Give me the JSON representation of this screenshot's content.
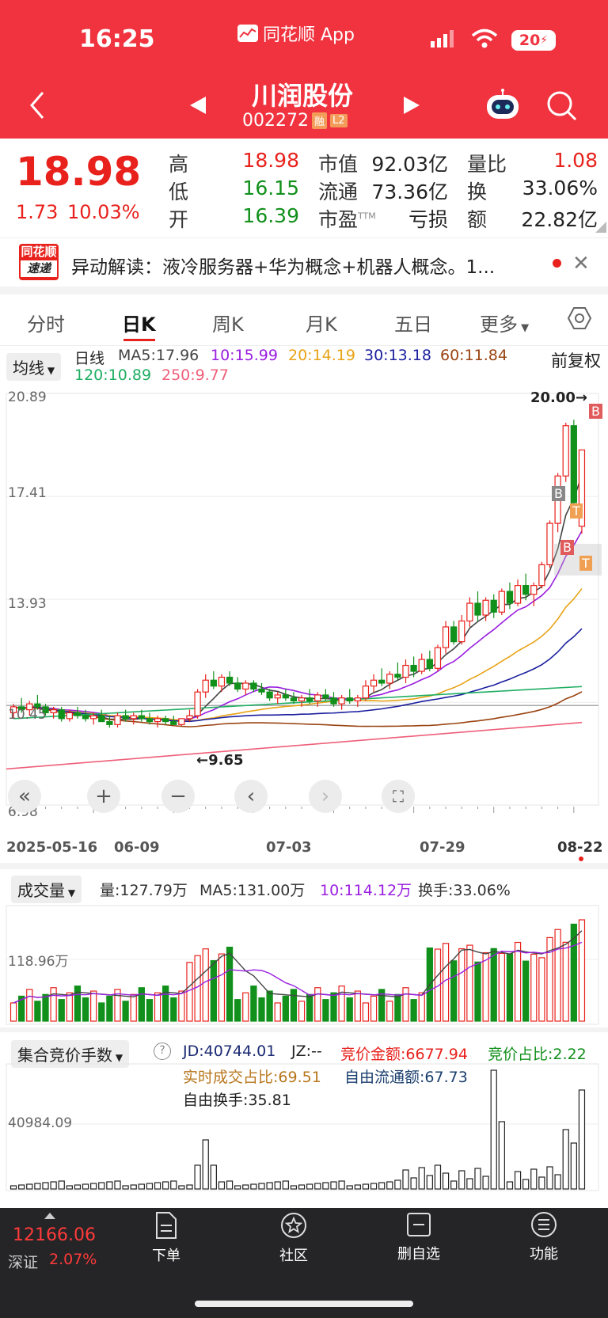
{
  "status": {
    "time": "16:25",
    "app": "同花顺 App",
    "battery": "20"
  },
  "header": {
    "title": "川润股份",
    "code": "002272",
    "badge1": "融",
    "badge2": "L2"
  },
  "quote": {
    "price": "18.98",
    "change": "1.73",
    "change_pct": "10.03%",
    "high_label": "高",
    "high": "18.98",
    "low_label": "低",
    "low": "16.15",
    "open_label": "开",
    "open": "16.39",
    "mcap_label": "市值",
    "mcap": "92.03亿",
    "float_label": "流通",
    "float": "73.36亿",
    "pe_label": "市盈",
    "pe_sup": "TTM",
    "pe": "亏损",
    "vr_label": "量比",
    "vr": "1.08",
    "turn_label": "换",
    "turn": "33.06%",
    "amt_label": "额",
    "amt": "22.82亿"
  },
  "news": {
    "logo_top": "同花顺",
    "logo_bottom": "速递",
    "text": "异动解读：液冷服务器+华为概念+机器人概念。1..."
  },
  "tabs": [
    "分时",
    "日K",
    "周K",
    "月K",
    "五日",
    "更多"
  ],
  "kline": {
    "selector": "均线",
    "period": "日线",
    "ma5": "MA5:17.96",
    "ma10": "10:15.99",
    "ma20": "20:14.19",
    "ma30": "30:13.18",
    "ma60": "60:11.84",
    "ma120": "120:10.89",
    "ma250": "250:9.77",
    "adjust": "前复权",
    "y_ticks": [
      "20.89",
      "17.41",
      "13.93",
      "10.45",
      "6.98"
    ],
    "high_mark": "20.00→",
    "low_mark": "←9.65",
    "dates": [
      "2025-05-16",
      "06-09",
      "07-03",
      "07-29",
      "08-22"
    ],
    "markers": [
      "B",
      "B",
      "T",
      "B",
      "T"
    ]
  },
  "volume": {
    "selector": "成交量",
    "vol": "量:127.79万",
    "ma5": "MA5:131.00万",
    "ma10": "10:114.12万",
    "turnover": "换手:33.06%",
    "y_tick": "118.96万"
  },
  "auction": {
    "selector": "集合竞价手数",
    "jd": "JD:40744.01",
    "jz": "JZ:--",
    "amount": "竞价金额:6677.94",
    "ratio": "竞价占比:2.22",
    "realtime": "实时成交占比:69.51",
    "free_float": "自由流通额:67.73",
    "free_turn": "自由换手:35.81",
    "y_tick": "40984.09"
  },
  "bottom": {
    "index_value": "12166.06",
    "index_name": "深证",
    "index_pct": "2.07%",
    "items": [
      "下单",
      "社区",
      "删自选",
      "功能"
    ]
  },
  "chart_data": {
    "type": "candlestick",
    "title": "川润股份 日K",
    "ylim": [
      6.98,
      20.89
    ],
    "x_range": [
      "2025-05-16",
      "08-22"
    ],
    "candles": [
      [
        10.1,
        10.4,
        9.9,
        10.3
      ],
      [
        10.3,
        10.6,
        10.1,
        10.2
      ],
      [
        10.2,
        10.5,
        10.0,
        10.4
      ],
      [
        10.4,
        10.7,
        10.2,
        10.3
      ],
      [
        10.3,
        10.4,
        10.0,
        10.1
      ],
      [
        10.1,
        10.3,
        9.9,
        10.2
      ],
      [
        10.2,
        10.3,
        9.8,
        9.9
      ],
      [
        9.9,
        10.2,
        9.8,
        10.1
      ],
      [
        10.1,
        10.3,
        9.9,
        10.0
      ],
      [
        10.0,
        10.2,
        9.8,
        9.9
      ],
      [
        9.9,
        10.1,
        9.7,
        10.0
      ],
      [
        10.0,
        10.2,
        9.8,
        9.8
      ],
      [
        9.8,
        10.0,
        9.6,
        9.7
      ],
      [
        9.7,
        10.1,
        9.6,
        10.0
      ],
      [
        10.0,
        10.2,
        9.8,
        9.9
      ],
      [
        9.9,
        10.1,
        9.7,
        10.0
      ],
      [
        10.0,
        10.2,
        9.8,
        9.9
      ],
      [
        9.9,
        10.1,
        9.7,
        9.8
      ],
      [
        9.8,
        10.0,
        9.6,
        9.9
      ],
      [
        9.9,
        10.0,
        9.7,
        9.8
      ],
      [
        9.8,
        10.0,
        9.7,
        9.7
      ],
      [
        9.7,
        9.9,
        9.65,
        9.9
      ],
      [
        9.9,
        10.2,
        9.8,
        10.0
      ],
      [
        10.0,
        10.9,
        9.9,
        10.8
      ],
      [
        10.8,
        11.4,
        10.6,
        11.2
      ],
      [
        11.2,
        11.5,
        10.9,
        11.0
      ],
      [
        11.0,
        11.4,
        10.8,
        11.3
      ],
      [
        11.3,
        11.5,
        11.0,
        11.1
      ],
      [
        11.1,
        11.3,
        10.8,
        10.9
      ],
      [
        10.9,
        11.2,
        10.7,
        11.1
      ],
      [
        11.1,
        11.2,
        10.8,
        10.9
      ],
      [
        10.9,
        11.1,
        10.7,
        10.8
      ],
      [
        10.8,
        10.9,
        10.5,
        10.6
      ],
      [
        10.6,
        10.8,
        10.4,
        10.7
      ],
      [
        10.7,
        10.9,
        10.5,
        10.6
      ],
      [
        10.6,
        10.8,
        10.4,
        10.5
      ],
      [
        10.5,
        10.7,
        10.3,
        10.6
      ],
      [
        10.6,
        10.9,
        10.4,
        10.5
      ],
      [
        10.5,
        10.8,
        10.3,
        10.7
      ],
      [
        10.7,
        10.9,
        10.5,
        10.6
      ],
      [
        10.6,
        10.8,
        10.3,
        10.4
      ],
      [
        10.4,
        10.7,
        10.2,
        10.6
      ],
      [
        10.6,
        10.9,
        10.4,
        10.5
      ],
      [
        10.5,
        10.7,
        10.3,
        10.6
      ],
      [
        10.6,
        11.2,
        10.5,
        11.0
      ],
      [
        11.0,
        11.4,
        10.8,
        11.2
      ],
      [
        11.2,
        11.6,
        11.0,
        11.1
      ],
      [
        11.1,
        11.5,
        10.9,
        11.4
      ],
      [
        11.4,
        11.8,
        11.2,
        11.3
      ],
      [
        11.3,
        11.9,
        11.1,
        11.7
      ],
      [
        11.7,
        12.0,
        11.3,
        11.5
      ],
      [
        11.5,
        12.1,
        11.4,
        11.9
      ],
      [
        11.9,
        12.2,
        11.5,
        11.6
      ],
      [
        11.6,
        12.4,
        11.5,
        12.3
      ],
      [
        12.3,
        13.2,
        12.1,
        13.0
      ],
      [
        13.0,
        13.2,
        12.4,
        12.5
      ],
      [
        12.5,
        13.4,
        12.4,
        13.2
      ],
      [
        13.2,
        14.0,
        13.0,
        13.8
      ],
      [
        13.8,
        14.2,
        13.2,
        13.4
      ],
      [
        13.4,
        14.0,
        13.2,
        13.9
      ],
      [
        13.9,
        14.1,
        13.3,
        13.5
      ],
      [
        13.5,
        14.3,
        13.4,
        14.2
      ],
      [
        14.2,
        14.5,
        13.6,
        13.8
      ],
      [
        13.8,
        14.6,
        13.7,
        14.4
      ],
      [
        14.4,
        14.8,
        13.9,
        14.1
      ],
      [
        14.1,
        14.5,
        13.7,
        14.4
      ],
      [
        14.4,
        15.2,
        14.3,
        15.1
      ],
      [
        15.1,
        16.6,
        15.0,
        16.5
      ],
      [
        16.5,
        18.2,
        16.2,
        18.1
      ],
      [
        18.1,
        19.9,
        17.9,
        19.8
      ],
      [
        19.8,
        20.0,
        17.0,
        17.2
      ],
      [
        16.4,
        18.98,
        16.15,
        18.98
      ]
    ]
  }
}
